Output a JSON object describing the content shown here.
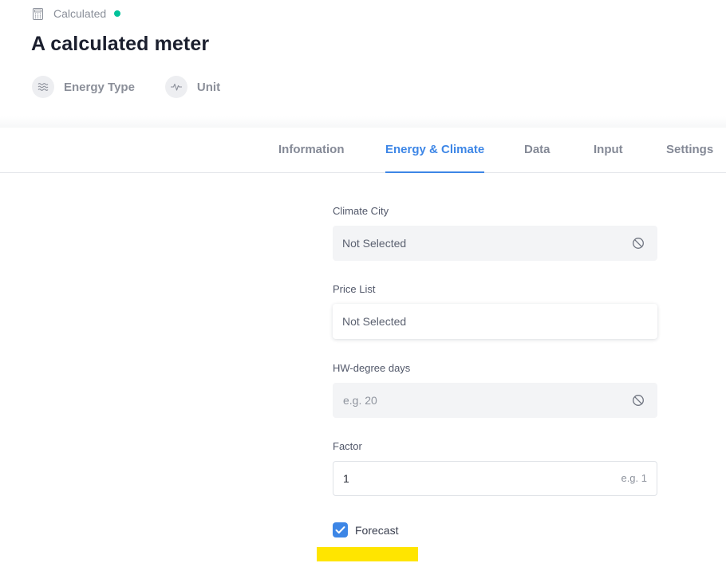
{
  "header": {
    "type_label": "Calculated",
    "status_color": "#00c29a",
    "title": "A calculated meter",
    "properties": [
      {
        "label": "Energy Type",
        "icon": "waves-icon"
      },
      {
        "label": "Unit",
        "icon": "pulse-icon"
      }
    ]
  },
  "tabs": [
    {
      "label": "Information",
      "active": false
    },
    {
      "label": "Energy & Climate",
      "active": true
    },
    {
      "label": "Data",
      "active": false
    },
    {
      "label": "Input",
      "active": false
    },
    {
      "label": "Settings",
      "active": false
    }
  ],
  "form": {
    "climate_city": {
      "label": "Climate City",
      "value": "Not Selected"
    },
    "price_list": {
      "label": "Price List",
      "value": "Not Selected"
    },
    "hw_degree_days": {
      "label": "HW-degree days",
      "placeholder": "e.g. 20"
    },
    "factor": {
      "label": "Factor",
      "value": "1",
      "hint": "e.g. 1"
    },
    "forecast": {
      "label": "Forecast",
      "checked": true
    }
  },
  "colors": {
    "accent": "#3d86e6",
    "status": "#00c29a",
    "highlight": "#ffe500"
  }
}
